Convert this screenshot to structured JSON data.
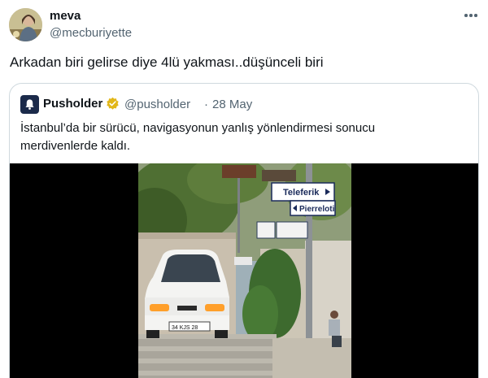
{
  "author": {
    "name": "meva",
    "handle": "@mecburiyette"
  },
  "tweet": {
    "text": "Arkadan biri gelirse diye 4lü yakması..düşünceli biri"
  },
  "quote": {
    "name": "Pusholder",
    "handle": "@pusholder",
    "separator": "·",
    "date": "28 May",
    "text_line1": "İstanbul’da bir sürücü, navigasyonun yanlış yönlendirmesi sonucu",
    "text_line2": "merdivenlerde kaldı."
  },
  "video": {
    "signs": {
      "teleferik": "Teleferik",
      "pierreloti": "Pierreloti"
    },
    "license_plate": "34 KJS 28"
  },
  "icons": {
    "more": "more-dots-icon",
    "verified": "verified-badge-icon",
    "bell": "bell-icon"
  },
  "colors": {
    "text_primary": "#0f1419",
    "text_secondary": "#536471",
    "border": "#cfd9de",
    "verified_gold": "#e2b719",
    "pusholder_brand": "#1b2a4a"
  }
}
